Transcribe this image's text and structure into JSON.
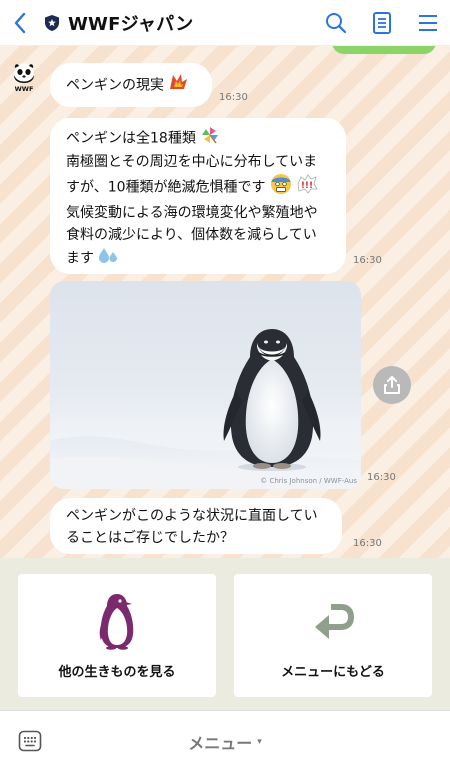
{
  "header": {
    "title": "WWFジャパン",
    "icons": [
      "back-icon",
      "shield-icon",
      "search-icon",
      "notes-icon",
      "menu-icon"
    ],
    "accent_color": "#2b75d9"
  },
  "chat": {
    "messages": [
      {
        "type": "text",
        "lines": [
          "ペンギンの現実"
        ],
        "emoji": "surprise-icon",
        "time": "16:30"
      },
      {
        "type": "text",
        "lines": [
          "ペンギンは全18種類",
          "南極圏とその周辺を中心に分布していま",
          "すが、10種類が絶滅危惧種です",
          "気候変動による海の環境変化や繁殖地や",
          "食料の減少により、個体数を減らしてい",
          "ます"
        ],
        "time": "16:30"
      },
      {
        "type": "image",
        "credit": "© Chris Johnson / WWF-Aus",
        "time": "16:30"
      },
      {
        "type": "text",
        "lines": [
          "ペンギンがこのような状況に直面してい",
          "ることはご存じでしたか？"
        ],
        "time": "16:30"
      }
    ]
  },
  "richmenu": {
    "left_label": "他の生きものを見る",
    "right_label": "メニューにもどる",
    "penguin_color": "#7b2a6e",
    "arrow_color": "#8f9f8c"
  },
  "bottom": {
    "menu_label": "メニュー",
    "caret": "▾"
  }
}
